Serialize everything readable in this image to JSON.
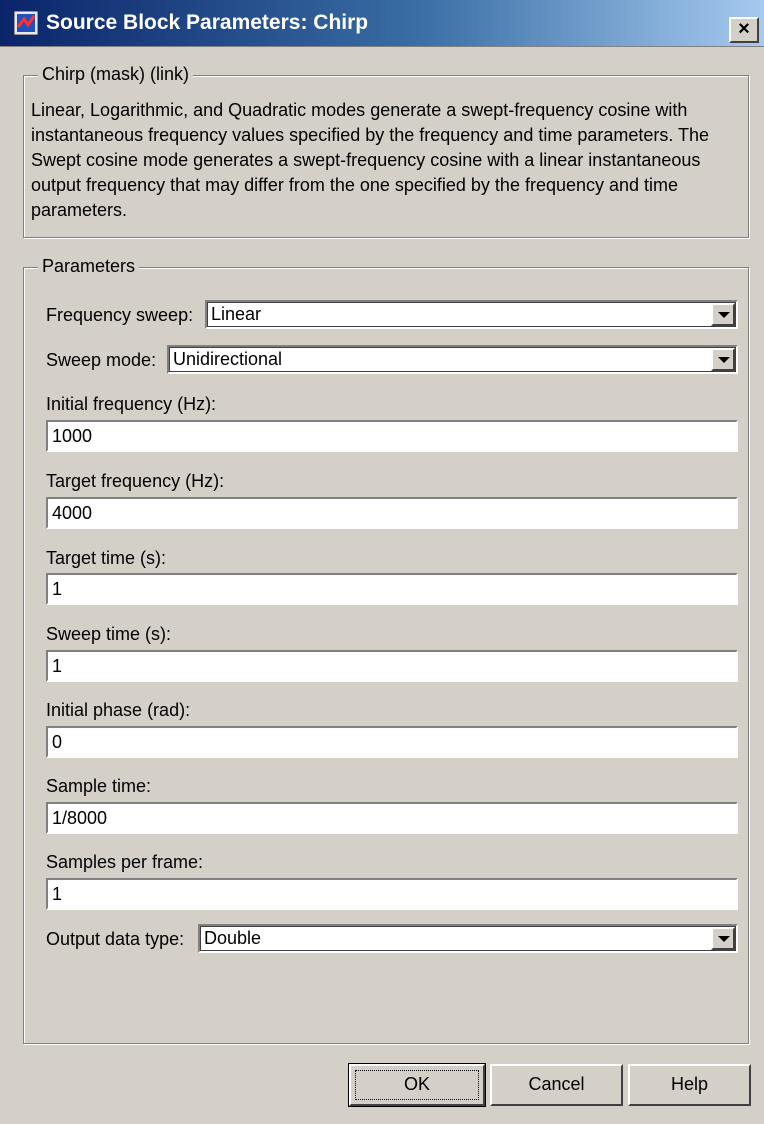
{
  "window": {
    "title": "Source Block Parameters: Chirp",
    "close_label": "×"
  },
  "description_group": {
    "legend": "Chirp (mask) (link)",
    "text": "Linear, Logarithmic, and Quadratic modes generate a swept-frequency cosine with instantaneous frequency values specified by the frequency and time parameters. The Swept cosine mode generates a swept-frequency cosine with a linear instantaneous output frequency that may differ from the one specified by the frequency and time parameters."
  },
  "parameters": {
    "legend": "Parameters",
    "frequency_sweep": {
      "label": "Frequency sweep:",
      "value": "Linear"
    },
    "sweep_mode": {
      "label": "Sweep mode:",
      "value": "Unidirectional"
    },
    "initial_frequency": {
      "label": "Initial frequency (Hz):",
      "value": "1000"
    },
    "target_frequency": {
      "label": "Target frequency (Hz):",
      "value": "4000"
    },
    "target_time": {
      "label": "Target time (s):",
      "value": "1"
    },
    "sweep_time": {
      "label": "Sweep time (s):",
      "value": "1"
    },
    "initial_phase": {
      "label": "Initial phase (rad):",
      "value": "0"
    },
    "sample_time": {
      "label": "Sample time:",
      "value": "1/8000"
    },
    "samples_per_frame": {
      "label": "Samples per frame:",
      "value": "1"
    },
    "output_data_type": {
      "label": "Output data type:",
      "value": "Double"
    }
  },
  "buttons": {
    "ok": "OK",
    "cancel": "Cancel",
    "help": "Help"
  },
  "colors": {
    "title_gradient_start": "#0a246a",
    "title_gradient_end": "#a6caf0",
    "dialog_background": "#d4d0c8"
  }
}
